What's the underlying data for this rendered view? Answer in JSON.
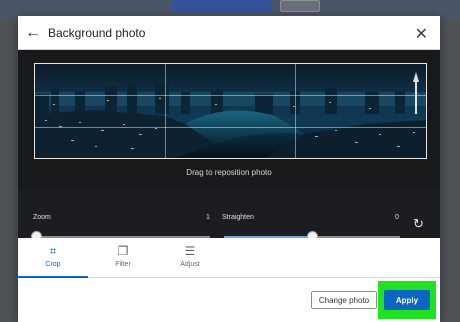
{
  "modal": {
    "title": "Background photo",
    "close_label": "✕",
    "back_label": "←"
  },
  "editor": {
    "drag_hint": "Drag to reposition photo",
    "zoom": {
      "label": "Zoom",
      "value": "1",
      "fraction": 0.0
    },
    "straighten": {
      "label": "Straighten",
      "value": "0",
      "fraction": 0.5
    }
  },
  "tabs": [
    {
      "label": "Crop",
      "icon": "crop-icon",
      "active": true
    },
    {
      "label": "Filter",
      "icon": "filter-icon",
      "active": false
    },
    {
      "label": "Adjust",
      "icon": "adjust-icon",
      "active": false
    }
  ],
  "footer": {
    "change_label": "Change photo",
    "apply_label": "Apply"
  },
  "colors": {
    "accent": "#0a66c2",
    "highlight": "#1ee31e",
    "editor_bg": "#17191b"
  }
}
